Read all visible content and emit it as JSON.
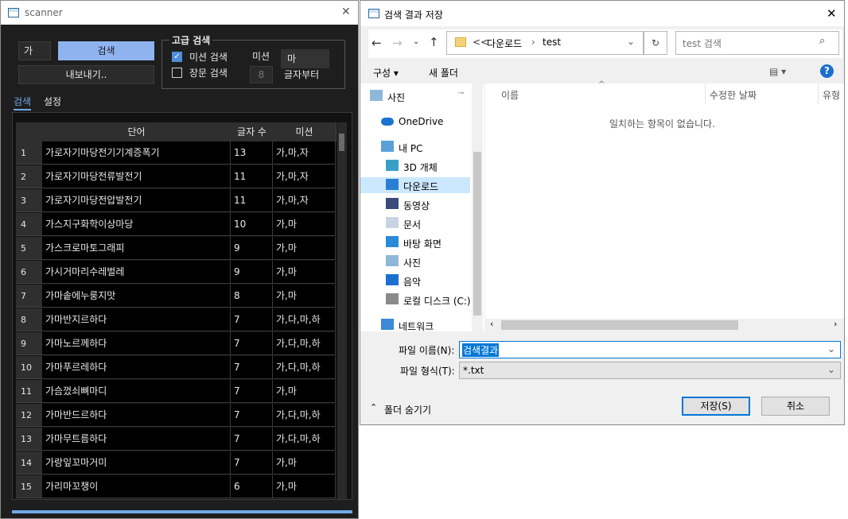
{
  "scanner": {
    "title": "scanner",
    "close": "✕",
    "search_input_value": "가",
    "search_button": "검색",
    "export_button": "내보내기..",
    "advanced": {
      "group_label": "고급 검색",
      "mission_checkbox_label": "미션 검색",
      "mission_checked": true,
      "long_checkbox_label": "장문 검색",
      "long_checked": false,
      "mission_label": "미션",
      "mission_value": "마",
      "length_value": "8",
      "length_suffix": "글자부터"
    },
    "tabs": [
      "검색",
      "설정"
    ],
    "table": {
      "columns": [
        "단어",
        "글자 수",
        "미션"
      ],
      "rows": [
        {
          "n": "1",
          "word": "가로자기마당전기기계증폭기",
          "len": "13",
          "mission": "가,마,자"
        },
        {
          "n": "2",
          "word": "가로자기마당전류발전기",
          "len": "11",
          "mission": "가,마,자"
        },
        {
          "n": "3",
          "word": "가로자기마당전압발전기",
          "len": "11",
          "mission": "가,마,자"
        },
        {
          "n": "4",
          "word": "가스지구화학이상마당",
          "len": "10",
          "mission": "가,마"
        },
        {
          "n": "5",
          "word": "가스크로마토그래피",
          "len": "9",
          "mission": "가,마"
        },
        {
          "n": "6",
          "word": "가시거마리수레벌레",
          "len": "9",
          "mission": "가,마"
        },
        {
          "n": "7",
          "word": "가마솥에누룽지맛",
          "len": "8",
          "mission": "가,마"
        },
        {
          "n": "8",
          "word": "가마반지르하다",
          "len": "7",
          "mission": "가,다,마,하"
        },
        {
          "n": "9",
          "word": "가마노르께하다",
          "len": "7",
          "mission": "가,다,마,하"
        },
        {
          "n": "10",
          "word": "가마푸르레하다",
          "len": "7",
          "mission": "가,다,마,하"
        },
        {
          "n": "11",
          "word": "가슴껐쇠뼈마디",
          "len": "7",
          "mission": "가,마"
        },
        {
          "n": "12",
          "word": "가마반드르하다",
          "len": "7",
          "mission": "가,다,마,하"
        },
        {
          "n": "13",
          "word": "가마무트름하다",
          "len": "7",
          "mission": "가,다,마,하"
        },
        {
          "n": "14",
          "word": "가랑잎꼬마거미",
          "len": "7",
          "mission": "가,마"
        },
        {
          "n": "15",
          "word": "가리마꼬챙이",
          "len": "6",
          "mission": "가,마"
        }
      ]
    }
  },
  "dialog": {
    "title": "검색 결과 저장",
    "close": "✕",
    "path": [
      "<<",
      "다운로드",
      "test"
    ],
    "search_placeholder": "test 검색",
    "toolbar": {
      "organize": "구성 ▾",
      "new_folder": "새 폴더",
      "help": "?"
    },
    "sidebar": [
      {
        "label": "사진",
        "icon": "pictures-icon"
      },
      {
        "label": "OneDrive",
        "icon": "onedrive-icon"
      },
      {
        "label": "내 PC",
        "icon": "pc-icon"
      },
      {
        "label": "3D 개체",
        "icon": "3d-objects-icon"
      },
      {
        "label": "다운로드",
        "icon": "download-icon"
      },
      {
        "label": "동영상",
        "icon": "video-icon"
      },
      {
        "label": "문서",
        "icon": "document-icon"
      },
      {
        "label": "바탕 화면",
        "icon": "desktop-icon"
      },
      {
        "label": "사진",
        "icon": "pictures-icon"
      },
      {
        "label": "음악",
        "icon": "music-icon"
      },
      {
        "label": "로컬 디스크 (C:)",
        "icon": "disk-icon"
      },
      {
        "label": "네트워크",
        "icon": "network-icon"
      }
    ],
    "columns": [
      "이름",
      "수정한 날짜",
      "유형"
    ],
    "empty_message": "일치하는 항목이 없습니다.",
    "filename_label": "파일 이름(N):",
    "filename_value": "검색결과",
    "filetype_label": "파일 형식(T):",
    "filetype_value": "*.txt",
    "hide_folders": "폴더 숨기기",
    "save_button": "저장(S)",
    "cancel_button": "취소",
    "colors": {
      "accent": "#0078d7",
      "selection": "#cce8ff"
    }
  }
}
